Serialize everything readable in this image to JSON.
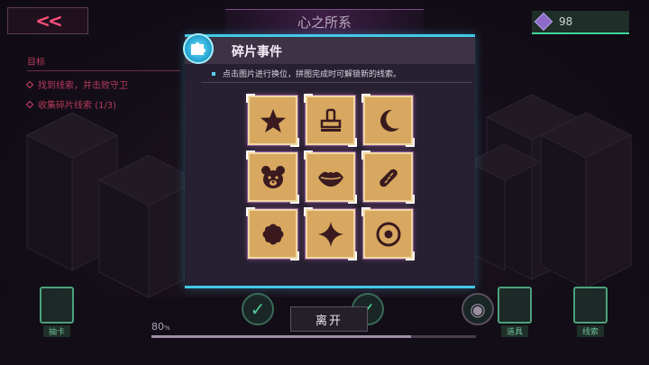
{
  "hud": {
    "back_label": "<<",
    "location_title": "心之所系",
    "resource_value": "98",
    "goals_title": "目标",
    "goals": [
      "找到线索，并击败守卫",
      "收集碎片线索 (1/3)"
    ],
    "progress_value": "80",
    "progress_unit": "%",
    "progress_fraction": 0.8,
    "bottom_left_items": [
      "抽卡",
      "道具"
    ],
    "bottom_right_label": "线索"
  },
  "dialog": {
    "title": "碎片事件",
    "hint": "点击图片进行换位，拼图完成时可解锁新的线索。",
    "tiles": [
      {
        "icon": "star-icon"
      },
      {
        "icon": "stamp-icon"
      },
      {
        "icon": "crescent-moon-icon"
      },
      {
        "icon": "bear-face-icon"
      },
      {
        "icon": "lips-icon"
      },
      {
        "icon": "bread-icon"
      },
      {
        "icon": "flower-icon"
      },
      {
        "icon": "four-point-star-icon"
      },
      {
        "icon": "target-icon"
      }
    ],
    "leave_label": "离开"
  },
  "colors": {
    "accent": "#43c9e8",
    "tile_fill": "#d8a860",
    "glyph": "#3a1a1e",
    "alert": "#d0446a"
  }
}
